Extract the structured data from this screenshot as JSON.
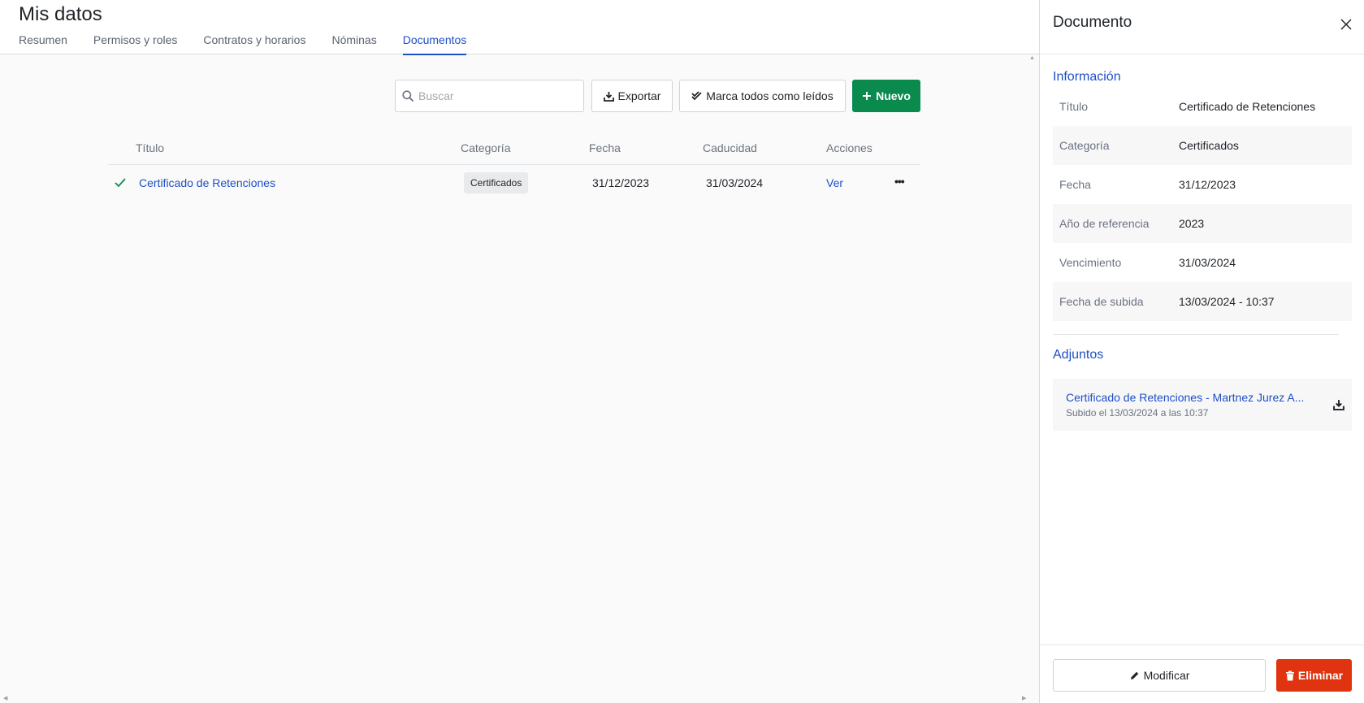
{
  "header": {
    "title": "Mis datos",
    "tabs": [
      {
        "label": "Resumen"
      },
      {
        "label": "Permisos y roles"
      },
      {
        "label": "Contratos y horarios"
      },
      {
        "label": "Nóminas"
      },
      {
        "label": "Documentos"
      }
    ],
    "active_tab": "Documentos"
  },
  "toolbar": {
    "search_placeholder": "Buscar",
    "export_label": "Exportar",
    "mark_all_label": "Marca todos como leídos",
    "new_label": "Nuevo"
  },
  "table": {
    "columns": [
      "Título",
      "Categoría",
      "Fecha",
      "Caducidad",
      "Acciones"
    ],
    "rows": [
      {
        "title": "Certificado de Retenciones",
        "category": "Certificados",
        "date": "31/12/2023",
        "expiry": "31/03/2024",
        "action": "Ver"
      }
    ]
  },
  "panel": {
    "title": "Documento",
    "info_title": "Información",
    "info": [
      {
        "label": "Título",
        "value": "Certificado de Retenciones"
      },
      {
        "label": "Categoría",
        "value": "Certificados"
      },
      {
        "label": "Fecha",
        "value": "31/12/2023"
      },
      {
        "label": "Año de referencia",
        "value": "2023"
      },
      {
        "label": "Vencimiento",
        "value": "31/03/2024"
      },
      {
        "label": "Fecha de subida",
        "value": "13/03/2024 - 10:37"
      }
    ],
    "attachments_title": "Adjuntos",
    "attachment": {
      "name": "Certificado de Retenciones - Martnez Jurez A...",
      "uploaded": "Subido el 13/03/2024 a las 10:37"
    },
    "modify_label": "Modificar",
    "delete_label": "Eliminar"
  },
  "colors": {
    "accent": "#1e4fc7",
    "primary_green": "#0b8a4e",
    "danger": "#e0330f"
  },
  "icons": {
    "search": "search-icon",
    "export": "download-icon",
    "mark_all": "double-check-icon",
    "new": "plus-icon",
    "row_read": "check-icon",
    "row_menu": "more-icon",
    "close": "close-icon",
    "attachment_download": "download-icon",
    "modify": "pencil-icon",
    "delete": "trash-icon"
  }
}
